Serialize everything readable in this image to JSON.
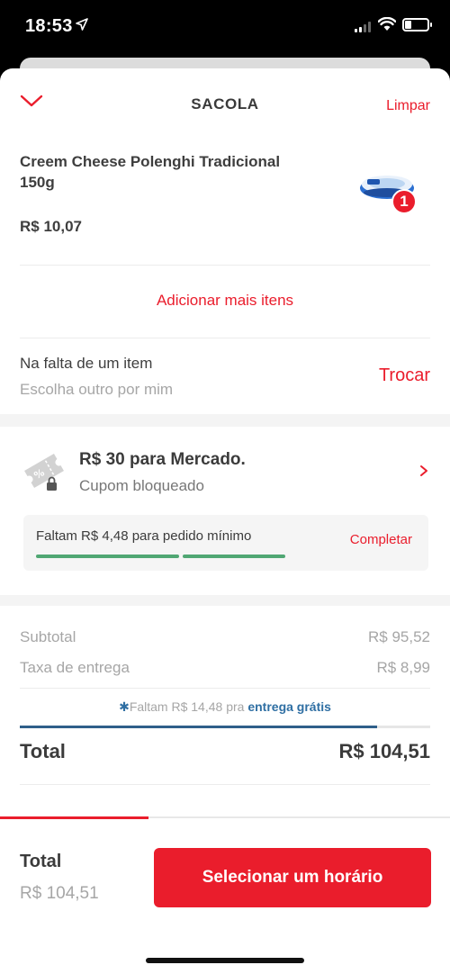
{
  "status_bar": {
    "time": "18:53"
  },
  "header": {
    "title": "SACOLA",
    "clear_label": "Limpar"
  },
  "cart": {
    "items": [
      {
        "name": "Creem Cheese Polenghi Tradicional 150g",
        "price": "R$ 10,07",
        "quantity": "1"
      }
    ],
    "add_more_label": "Adicionar mais itens"
  },
  "missing_item": {
    "title": "Na falta de um item",
    "subtitle": "Escolha outro por mim",
    "action_label": "Trocar"
  },
  "coupon": {
    "title": "R$ 30 para Mercado.",
    "subtitle": "Cupom bloqueado",
    "minimum_message": "Faltam R$ 4,48 para pedido mínimo",
    "complete_label": "Completar",
    "minimum_progress": 0.86
  },
  "summary": {
    "subtotal_label": "Subtotal",
    "subtotal_value": "R$ 95,52",
    "delivery_label": "Taxa de entrega",
    "delivery_value": "R$ 8,99",
    "free_shipping_prefix": "Faltam R$ 14,48 pra ",
    "free_shipping_strong": "entrega grátis",
    "free_shipping_progress": 0.87,
    "total_label": "Total",
    "total_value": "R$ 104,51"
  },
  "footer": {
    "total_label": "Total",
    "total_value": "R$ 104,51",
    "schedule_label": "Selecionar um horário",
    "step_progress": 0.33
  },
  "colors": {
    "brand_red": "#ea1d2c",
    "progress_green": "#50a773",
    "shipping_blue": "#2f5f8a"
  },
  "icons": {
    "back": "chevron-down-icon",
    "coupon": "coupon-ticket-icon",
    "lock": "lock-icon",
    "arrow": "chevron-right-icon",
    "shipping": "gear-icon"
  }
}
